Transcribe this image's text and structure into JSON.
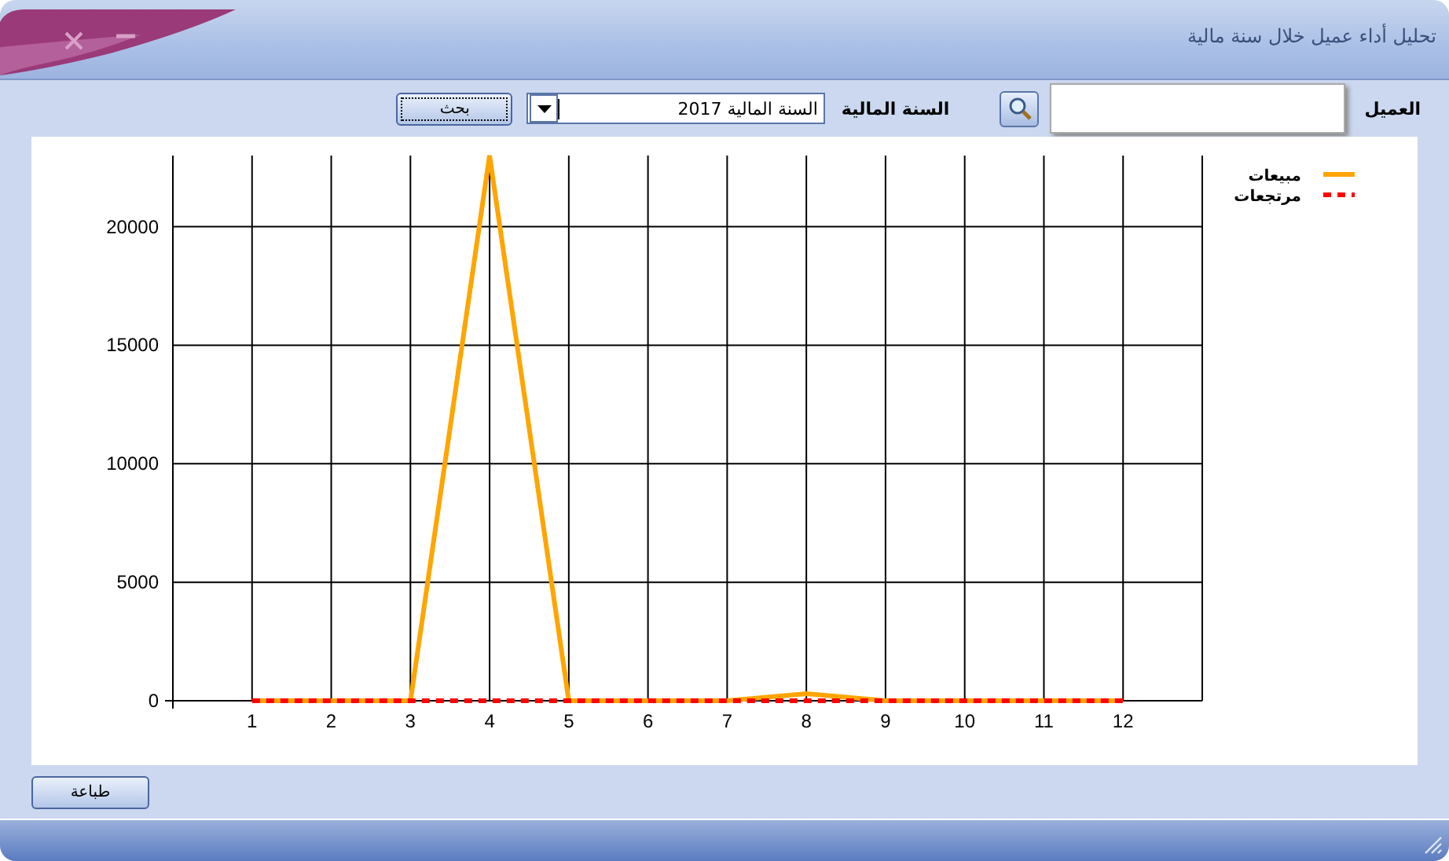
{
  "window": {
    "title": "تحليل أداء عميل خلال سنة مالية"
  },
  "toolbar": {
    "customer_label": "العميل",
    "year_label": "السنة المالية",
    "year": {
      "value": "السنة المالية 2017"
    },
    "search_button": "بحث"
  },
  "chart": {
    "chart_data": {
      "type": "line",
      "x": [
        1,
        2,
        3,
        4,
        5,
        6,
        7,
        8,
        9,
        10,
        11,
        12
      ],
      "xlim": [
        0,
        13
      ],
      "ylim": [
        0,
        23000
      ],
      "xticks": [
        1,
        2,
        3,
        4,
        5,
        6,
        7,
        8,
        9,
        10,
        11,
        12
      ],
      "yticks": [
        0,
        5000,
        10000,
        15000,
        20000
      ],
      "grid": true,
      "legend": true,
      "series": [
        {
          "name": "مبيعات",
          "color": "#ffa500",
          "line_style": "solid",
          "values": [
            0,
            0,
            0,
            23000,
            0,
            0,
            0,
            300,
            0,
            0,
            0,
            0
          ]
        },
        {
          "name": "مرتجعات",
          "color": "#ff0000",
          "line_style": "dashed",
          "values": [
            0,
            0,
            0,
            0,
            0,
            0,
            0,
            0,
            0,
            0,
            0,
            0
          ]
        }
      ]
    }
  },
  "print_button": "طباعة"
}
